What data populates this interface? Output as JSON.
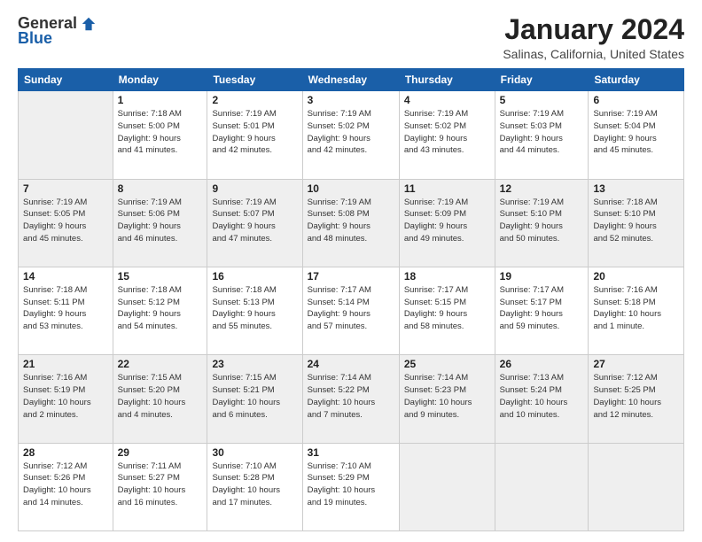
{
  "logo": {
    "general": "General",
    "blue": "Blue"
  },
  "title": "January 2024",
  "location": "Salinas, California, United States",
  "weekdays": [
    "Sunday",
    "Monday",
    "Tuesday",
    "Wednesday",
    "Thursday",
    "Friday",
    "Saturday"
  ],
  "weeks": [
    [
      {
        "day": "",
        "info": ""
      },
      {
        "day": "1",
        "info": "Sunrise: 7:18 AM\nSunset: 5:00 PM\nDaylight: 9 hours\nand 41 minutes."
      },
      {
        "day": "2",
        "info": "Sunrise: 7:19 AM\nSunset: 5:01 PM\nDaylight: 9 hours\nand 42 minutes."
      },
      {
        "day": "3",
        "info": "Sunrise: 7:19 AM\nSunset: 5:02 PM\nDaylight: 9 hours\nand 42 minutes."
      },
      {
        "day": "4",
        "info": "Sunrise: 7:19 AM\nSunset: 5:02 PM\nDaylight: 9 hours\nand 43 minutes."
      },
      {
        "day": "5",
        "info": "Sunrise: 7:19 AM\nSunset: 5:03 PM\nDaylight: 9 hours\nand 44 minutes."
      },
      {
        "day": "6",
        "info": "Sunrise: 7:19 AM\nSunset: 5:04 PM\nDaylight: 9 hours\nand 45 minutes."
      }
    ],
    [
      {
        "day": "7",
        "info": "Sunrise: 7:19 AM\nSunset: 5:05 PM\nDaylight: 9 hours\nand 45 minutes."
      },
      {
        "day": "8",
        "info": "Sunrise: 7:19 AM\nSunset: 5:06 PM\nDaylight: 9 hours\nand 46 minutes."
      },
      {
        "day": "9",
        "info": "Sunrise: 7:19 AM\nSunset: 5:07 PM\nDaylight: 9 hours\nand 47 minutes."
      },
      {
        "day": "10",
        "info": "Sunrise: 7:19 AM\nSunset: 5:08 PM\nDaylight: 9 hours\nand 48 minutes."
      },
      {
        "day": "11",
        "info": "Sunrise: 7:19 AM\nSunset: 5:09 PM\nDaylight: 9 hours\nand 49 minutes."
      },
      {
        "day": "12",
        "info": "Sunrise: 7:19 AM\nSunset: 5:10 PM\nDaylight: 9 hours\nand 50 minutes."
      },
      {
        "day": "13",
        "info": "Sunrise: 7:18 AM\nSunset: 5:10 PM\nDaylight: 9 hours\nand 52 minutes."
      }
    ],
    [
      {
        "day": "14",
        "info": "Sunrise: 7:18 AM\nSunset: 5:11 PM\nDaylight: 9 hours\nand 53 minutes."
      },
      {
        "day": "15",
        "info": "Sunrise: 7:18 AM\nSunset: 5:12 PM\nDaylight: 9 hours\nand 54 minutes."
      },
      {
        "day": "16",
        "info": "Sunrise: 7:18 AM\nSunset: 5:13 PM\nDaylight: 9 hours\nand 55 minutes."
      },
      {
        "day": "17",
        "info": "Sunrise: 7:17 AM\nSunset: 5:14 PM\nDaylight: 9 hours\nand 57 minutes."
      },
      {
        "day": "18",
        "info": "Sunrise: 7:17 AM\nSunset: 5:15 PM\nDaylight: 9 hours\nand 58 minutes."
      },
      {
        "day": "19",
        "info": "Sunrise: 7:17 AM\nSunset: 5:17 PM\nDaylight: 9 hours\nand 59 minutes."
      },
      {
        "day": "20",
        "info": "Sunrise: 7:16 AM\nSunset: 5:18 PM\nDaylight: 10 hours\nand 1 minute."
      }
    ],
    [
      {
        "day": "21",
        "info": "Sunrise: 7:16 AM\nSunset: 5:19 PM\nDaylight: 10 hours\nand 2 minutes."
      },
      {
        "day": "22",
        "info": "Sunrise: 7:15 AM\nSunset: 5:20 PM\nDaylight: 10 hours\nand 4 minutes."
      },
      {
        "day": "23",
        "info": "Sunrise: 7:15 AM\nSunset: 5:21 PM\nDaylight: 10 hours\nand 6 minutes."
      },
      {
        "day": "24",
        "info": "Sunrise: 7:14 AM\nSunset: 5:22 PM\nDaylight: 10 hours\nand 7 minutes."
      },
      {
        "day": "25",
        "info": "Sunrise: 7:14 AM\nSunset: 5:23 PM\nDaylight: 10 hours\nand 9 minutes."
      },
      {
        "day": "26",
        "info": "Sunrise: 7:13 AM\nSunset: 5:24 PM\nDaylight: 10 hours\nand 10 minutes."
      },
      {
        "day": "27",
        "info": "Sunrise: 7:12 AM\nSunset: 5:25 PM\nDaylight: 10 hours\nand 12 minutes."
      }
    ],
    [
      {
        "day": "28",
        "info": "Sunrise: 7:12 AM\nSunset: 5:26 PM\nDaylight: 10 hours\nand 14 minutes."
      },
      {
        "day": "29",
        "info": "Sunrise: 7:11 AM\nSunset: 5:27 PM\nDaylight: 10 hours\nand 16 minutes."
      },
      {
        "day": "30",
        "info": "Sunrise: 7:10 AM\nSunset: 5:28 PM\nDaylight: 10 hours\nand 17 minutes."
      },
      {
        "day": "31",
        "info": "Sunrise: 7:10 AM\nSunset: 5:29 PM\nDaylight: 10 hours\nand 19 minutes."
      },
      {
        "day": "",
        "info": ""
      },
      {
        "day": "",
        "info": ""
      },
      {
        "day": "",
        "info": ""
      }
    ]
  ]
}
